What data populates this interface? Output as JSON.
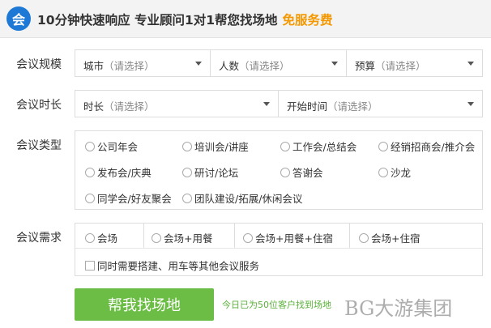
{
  "header": {
    "logo_glyph": "会",
    "title": "10分钟快速响应 专业顾问1对1帮您找场地",
    "free_text": "免服务费"
  },
  "rows": {
    "scale": {
      "label": "会议规模",
      "city": {
        "label": "城市",
        "placeholder": "（请选择）"
      },
      "people": {
        "label": "人数",
        "placeholder": "（请选择）"
      },
      "budget": {
        "label": "预算",
        "placeholder": "（请选择）"
      }
    },
    "duration": {
      "label": "会议时长",
      "duration": {
        "label": "时长",
        "placeholder": "（请选择）"
      },
      "start_time": {
        "label": "开始时间",
        "placeholder": "（请选择）"
      }
    },
    "type": {
      "label": "会议类型",
      "options": [
        "公司年会",
        "培训会/讲座",
        "工作会/总结会",
        "经销招商会/推介会",
        "发布会/庆典",
        "研讨/论坛",
        "答谢会",
        "沙龙",
        "同学会/好友聚会",
        "团队建设/拓展/休闲会议"
      ]
    },
    "needs": {
      "label": "会议需求",
      "options": [
        "会场",
        "会场+用餐",
        "会场+用餐+住宿",
        "会场+住宿"
      ],
      "extra_checkbox": "同时需要搭建、用车等其他会议服务"
    }
  },
  "submit_label": "帮我找场地",
  "notice": "今日已为50位客户找到场地",
  "watermark": "BG大游集团",
  "colors": {
    "accent_orange": "#f39800",
    "button_green": "#6cbd45",
    "logo_blue": "#1e79d6"
  }
}
